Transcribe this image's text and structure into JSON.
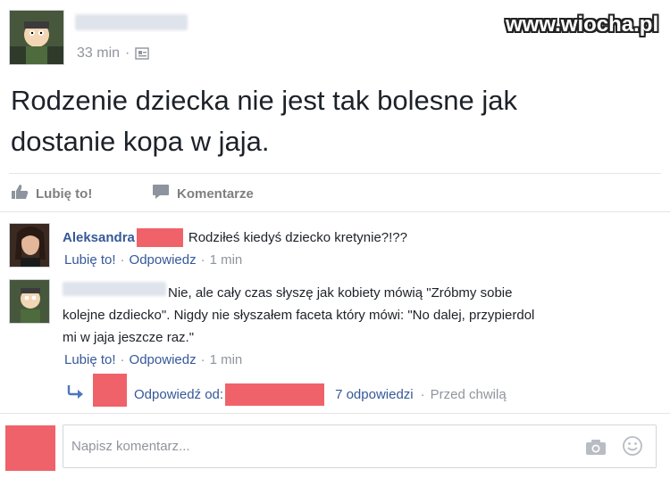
{
  "watermark": "www.wiocha.pl",
  "post": {
    "time": "33 min",
    "separator": "·",
    "text_line1": "Rodzenie dziecka nie jest tak bolesne jak",
    "text_line2": "dostanie kopa w jaja."
  },
  "actions": {
    "like_label": "Lubię to!",
    "comment_label": "Komentarze"
  },
  "comments": [
    {
      "author": "Aleksandra",
      "text": "Rodziłeś kiedyś dziecko kretynie?!??",
      "like": "Lubię to!",
      "reply": "Odpowiedz",
      "time": "1 min"
    },
    {
      "text_line1": "Nie, ale cały czas słyszę jak kobiety mówią \"Zróbmy sobie",
      "text_line2": "kolejne dzdiecko\". Nigdy nie słyszałem faceta który mówi: \"No dalej, przypierdol",
      "text_line3": "mi w jaja jeszcze raz.\"",
      "like": "Lubię to!",
      "reply": "Odpowiedz",
      "time": "1 min"
    }
  ],
  "reply_summary": {
    "label": "Odpowiedź od:",
    "count": "7 odpowiedzi",
    "time": "Przed chwilą"
  },
  "composer": {
    "placeholder": "Napisz komentarz..."
  },
  "colors": {
    "link": "#365899",
    "redaction": "#f0626a",
    "meta_grey": "#90949c"
  }
}
